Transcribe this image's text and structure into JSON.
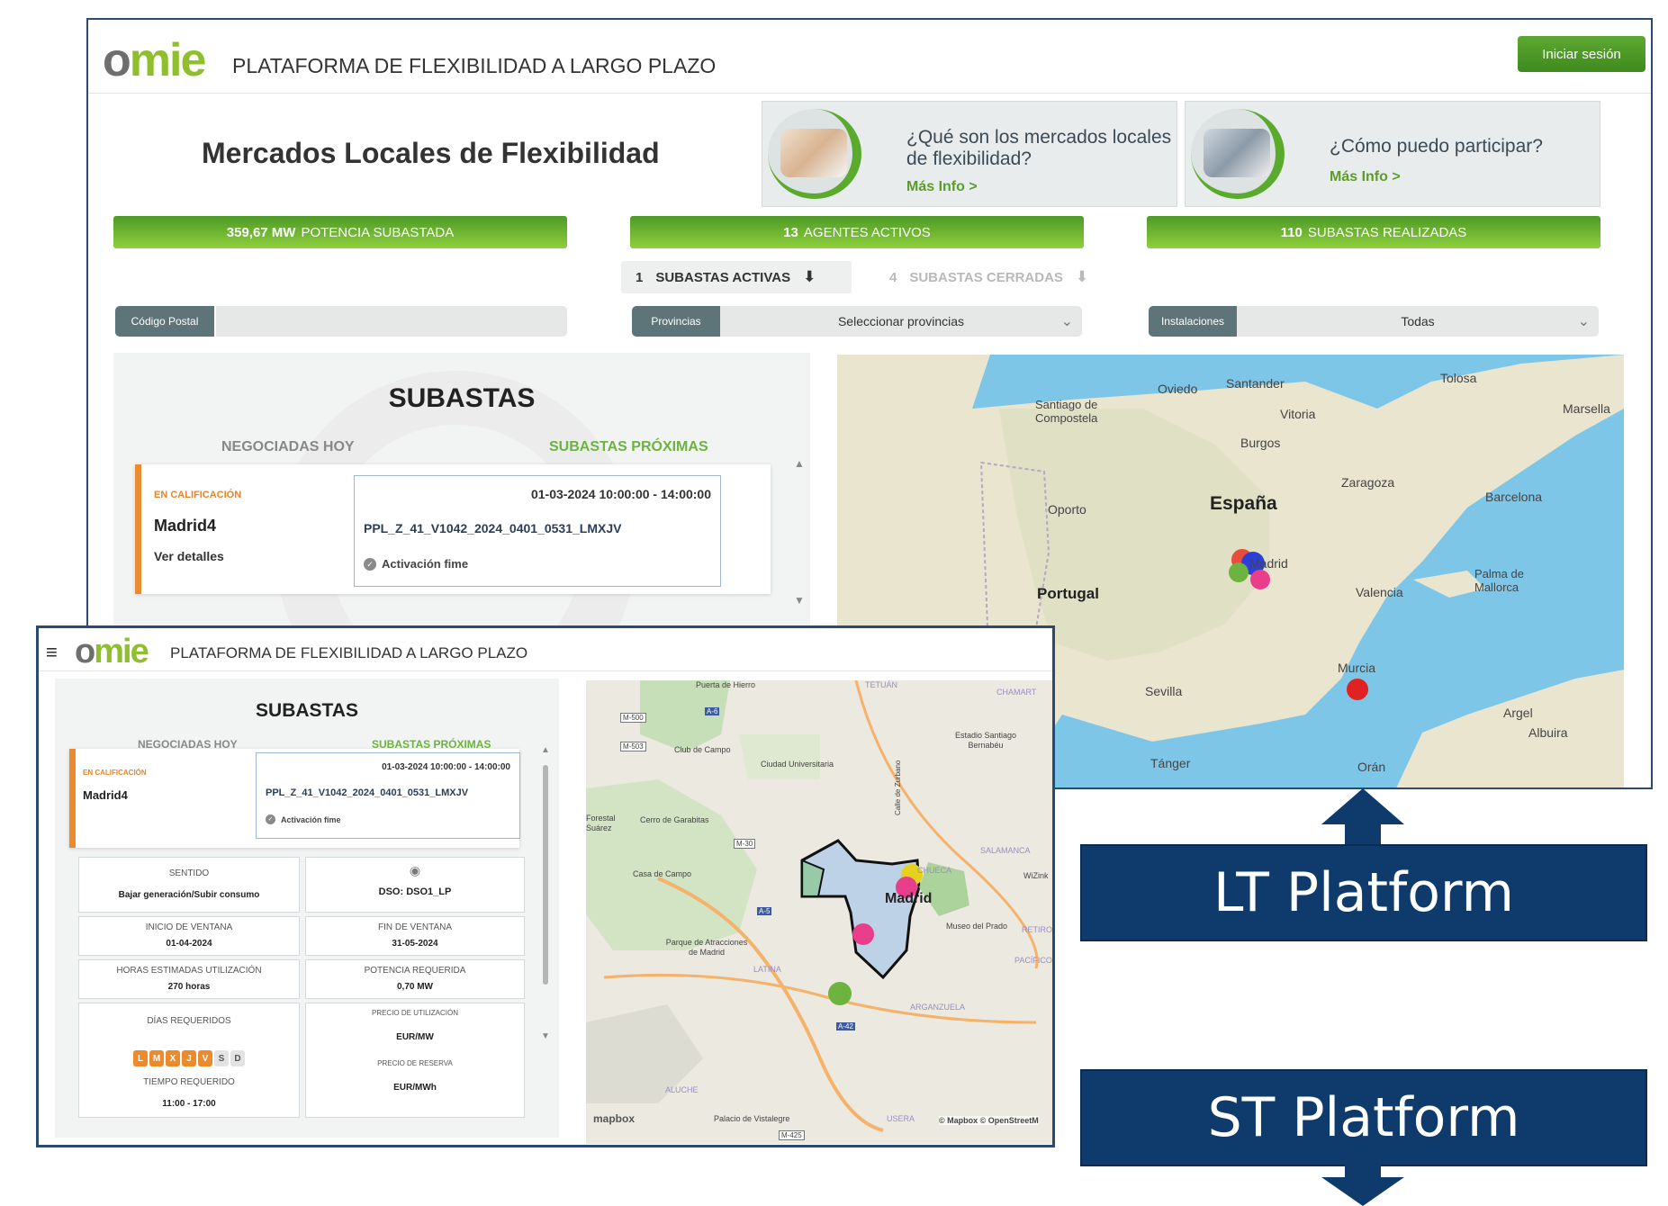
{
  "lt": {
    "header": {
      "logo_text_a": "o",
      "logo_text_b": "mie",
      "title": "PLATAFORMA DE FLEXIBILIDAD A LARGO PLAZO",
      "login_button": "Iniciar sesión"
    },
    "hero_title": "Mercados Locales de Flexibilidad",
    "info_cards": [
      {
        "question": "¿Qué son los mercados locales de flexibilidad?",
        "more": "Más Info >"
      },
      {
        "question": "¿Cómo puedo participar?",
        "more": "Más Info >"
      }
    ],
    "stats": [
      {
        "value": "359,67 MW",
        "label": "POTENCIA SUBASTADA"
      },
      {
        "value": "13",
        "label": "AGENTES ACTIVOS"
      },
      {
        "value": "110",
        "label": "SUBASTAS REALIZADAS"
      }
    ],
    "auction_tabs": {
      "active_count": "1",
      "active_label": "SUBASTAS ACTIVAS",
      "closed_count": "4",
      "closed_label": "SUBASTAS CERRADAS"
    },
    "filters": {
      "postal_label": "Código Postal",
      "postal_value": "",
      "provinces_label": "Provincias",
      "provinces_value": "Seleccionar provincias",
      "installations_label": "Instalaciones",
      "installations_value": "Todas"
    },
    "subastas": {
      "title": "SUBASTAS",
      "tab_today": "NEGOCIADAS HOY",
      "tab_upcoming": "SUBASTAS PRÓXIMAS",
      "auction": {
        "state": "EN CALIFICACIÓN",
        "name": "Madrid4",
        "details": "Ver detalles",
        "datetime": "01-03-2024 10:00:00 - 14:00:00",
        "code": "PPL_Z_41_V1042_2024_0401_0531_LMXJV",
        "activation": "Activación fime"
      }
    },
    "map_labels": {
      "oviedo": "Oviedo",
      "santander": "Santander",
      "tolosa": "Tolosa",
      "santiago": "Santiago de Compostela",
      "vitoria": "Vitoria",
      "marsella": "Marsella",
      "burgos": "Burgos",
      "zaragoza": "Zaragoza",
      "oporto": "Oporto",
      "espana": "España",
      "barcelona": "Barcelona",
      "madrid": "Madrid",
      "portugal": "Portugal",
      "valencia": "Valencia",
      "palma": "Palma de Mallorca",
      "murcia": "Murcia",
      "sevilla": "Sevilla",
      "argel": "Argel",
      "albuira": "Albuira",
      "tanger": "Tánger",
      "oran": "Orán"
    }
  },
  "st": {
    "header": {
      "logo_text_a": "o",
      "logo_text_b": "mie",
      "title": "PLATAFORMA DE FLEXIBILIDAD A LARGO PLAZO"
    },
    "subastas": {
      "title": "SUBASTAS",
      "tab_today": "NEGOCIADAS HOY",
      "tab_upcoming": "SUBASTAS PRÓXIMAS",
      "auction": {
        "state": "EN CALIFICACIÓN",
        "name": "Madrid4",
        "datetime": "01-03-2024 10:00:00 - 14:00:00",
        "code": "PPL_Z_41_V1042_2024_0401_0531_LMXJV",
        "activation": "Activación fime"
      },
      "details": {
        "sentido_label": "SENTIDO",
        "sentido_value": "Bajar generación/Subir consumo",
        "dso_value": "DSO: DSO1_LP",
        "inicio_label": "INICIO DE VENTANA",
        "inicio_value": "01-04-2024",
        "fin_label": "FIN DE VENTANA",
        "fin_value": "31-05-2024",
        "horas_label": "HORAS ESTIMADAS UTILIZACIÓN",
        "horas_value": "270 horas",
        "potencia_label": "POTENCIA REQUERIDA",
        "potencia_value": "0,70 MW",
        "dias_label": "DÍAS REQUERIDOS",
        "days": [
          "L",
          "M",
          "X",
          "J",
          "V",
          "S",
          "D"
        ],
        "days_active": [
          true,
          true,
          true,
          true,
          true,
          false,
          false
        ],
        "tiempo_label": "TIEMPO REQUERIDO",
        "tiempo_value": "11:00 - 17:00",
        "precio_util_label": "PRECIO DE UTILIZACIÓN",
        "precio_util_value": "EUR/MW",
        "precio_res_label": "PRECIO DE RESERVA",
        "precio_res_value": "EUR/MWh"
      }
    },
    "map_labels": {
      "puerta": "Puerta de Hierro",
      "tetuan": "TETUÁN",
      "chamart": "CHAMART",
      "club": "Club de Campo",
      "estadio": "Estadio Santiago Bernabéu",
      "ciudad": "Ciudad Universitaria",
      "forestal": "Forestal Suárez",
      "garabitas": "Cerro de Garabitas",
      "zurbano": "Calle de Zurbano",
      "salamanca": "SALAMANCA",
      "chueca": "CHUECA",
      "wizink": "WiZink",
      "casa": "Casa de Campo",
      "madrid": "Madrid",
      "prado": "Museo del Prado",
      "retiro": "RETIRO",
      "parque": "Parque de Atracciones de Madrid",
      "latina": "LATINA",
      "pacifico": "PACÍFICO",
      "arganzuela": "ARGANZUELA",
      "aluche": "ALUCHE",
      "vistalegre": "Palacio de Vistalegre",
      "usera": "USERA",
      "mapbox": "mapbox",
      "attribution": "© Mapbox © OpenStreetM",
      "m500": "M-500",
      "m503": "M-503",
      "a6": "A-6",
      "m30": "M-30",
      "a5": "A-5",
      "a42": "A-42",
      "m425": "M-425"
    }
  },
  "banners": {
    "lt": "LT Platform",
    "st": "ST Platform"
  },
  "colors": {
    "green_primary": "#5ea832",
    "green_light": "#8fcf3c",
    "orange_accent": "#ec8a2c",
    "slate_label": "#5d7478",
    "banner_blue": "#0e3b6b",
    "frame_blue": "#2b4a73"
  }
}
